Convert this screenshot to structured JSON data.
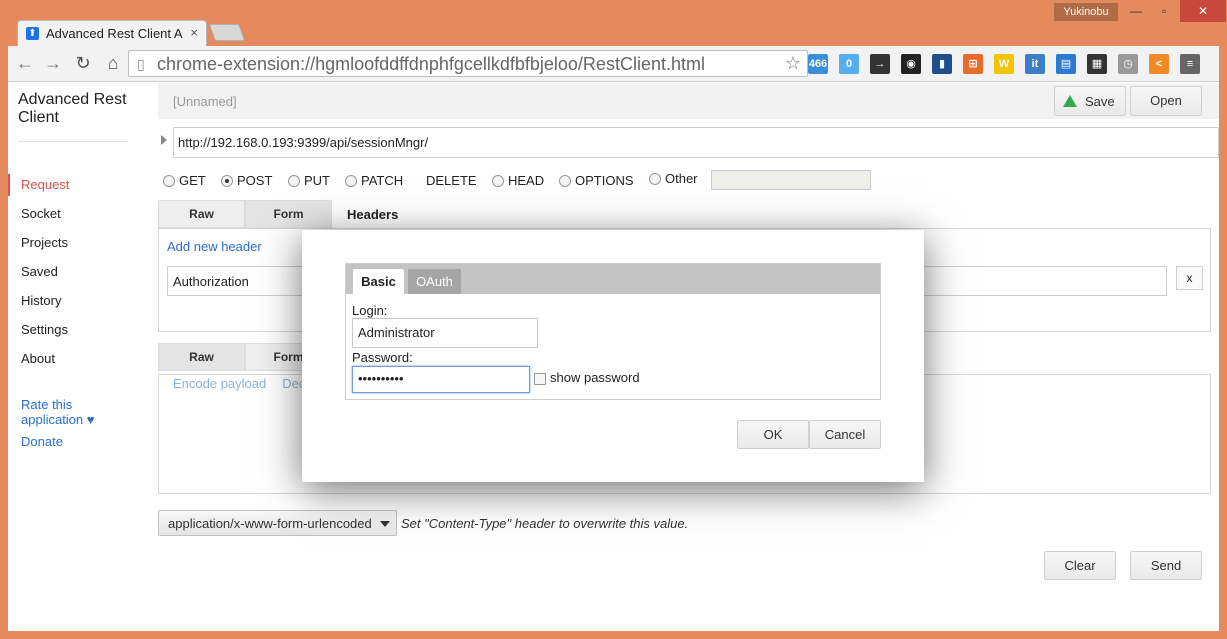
{
  "browser": {
    "tab_title": "Advanced Rest Client A",
    "tab_close": "×",
    "user": "Yukinobu",
    "url": "chrome-extension://hgmloofddffdnphfgcellkdfbfbjeloo/RestClient.html",
    "back": "←",
    "forward": "→",
    "reload": "↻",
    "home": "⌂",
    "star": "☆",
    "win_min": "—",
    "win_max": "▫",
    "win_close": "✕",
    "extensions": [
      {
        "name": "twitter",
        "color": "#3a8fd6",
        "glyph": "466"
      },
      {
        "name": "tweetdeck",
        "color": "#55acee",
        "glyph": "0"
      },
      {
        "name": "share",
        "color": "#333333",
        "glyph": "→"
      },
      {
        "name": "color",
        "color": "#222222",
        "glyph": "◉"
      },
      {
        "name": "stats",
        "color": "#1f4e8c",
        "glyph": "▮"
      },
      {
        "name": "cart",
        "color": "#e96b2a",
        "glyph": "⊞"
      },
      {
        "name": "w",
        "color": "#f4c400",
        "glyph": "W"
      },
      {
        "name": "it",
        "color": "#3d7cc9",
        "glyph": "it"
      },
      {
        "name": "window",
        "color": "#2a7ad1",
        "glyph": "▤"
      },
      {
        "name": "film",
        "color": "#333333",
        "glyph": "▦"
      },
      {
        "name": "clock",
        "color": "#999999",
        "glyph": "◷"
      },
      {
        "name": "share2",
        "color": "#f08a24",
        "glyph": "<"
      },
      {
        "name": "menu",
        "color": "#666666",
        "glyph": "≡"
      }
    ]
  },
  "sidebar": {
    "title": "Advanced Rest Client",
    "items": [
      "Request",
      "Socket",
      "Projects",
      "Saved",
      "History",
      "Settings",
      "About"
    ],
    "rate": "Rate this application ♥",
    "donate": "Donate"
  },
  "topbar": {
    "name": "[Unnamed]",
    "save": "Save",
    "open": "Open"
  },
  "request": {
    "url": "http://192.168.0.193:9399/api/sessionMngr/",
    "methods": [
      "GET",
      "POST",
      "PUT",
      "PATCH",
      "DELETE",
      "HEAD",
      "OPTIONS",
      "Other"
    ],
    "selected_method": "POST",
    "headers_tabs": [
      "Raw",
      "Form"
    ],
    "headers_title": "Headers",
    "add_header": "Add new header",
    "header_name": "Authorization",
    "header_remove": "x",
    "payload_tabs": [
      "Raw",
      "Form"
    ],
    "encode": "Encode payload",
    "decode": "Dec",
    "content_type": "application/x-www-form-urlencoded",
    "content_type_hint": "Set \"Content-Type\" header to overwrite this value.",
    "clear": "Clear",
    "send": "Send"
  },
  "auth_dialog": {
    "tabs": [
      "Basic",
      "OAuth"
    ],
    "login_label": "Login:",
    "login_value": "Administrator",
    "password_label": "Password:",
    "password_value": "••••••••••",
    "show_password": "show password",
    "ok": "OK",
    "cancel": "Cancel"
  }
}
